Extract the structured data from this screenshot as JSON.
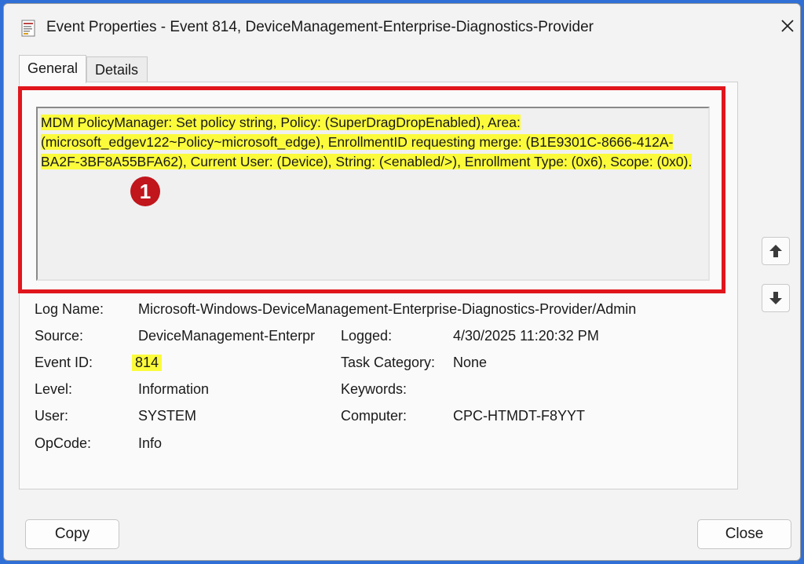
{
  "window": {
    "title": "Event Properties - Event 814, DeviceManagement-Enterprise-Diagnostics-Provider"
  },
  "tabs": [
    {
      "label": "General",
      "active": true
    },
    {
      "label": "Details",
      "active": false
    }
  ],
  "description": "MDM PolicyManager: Set policy string, Policy: (SuperDragDropEnabled), Area: (microsoft_edgev122~Policy~microsoft_edge), EnrollmentID requesting merge: (B1E9301C-8666-412A-BA2F-3BF8A55BFA62), Current User: (Device), String: (<enabled/>), Enrollment Type: (0x6), Scope: (0x0).",
  "annotation": {
    "badge": "1"
  },
  "fields": {
    "log_name": {
      "label": "Log Name:",
      "value": "Microsoft-Windows-DeviceManagement-Enterprise-Diagnostics-Provider/Admin"
    },
    "source": {
      "label": "Source:",
      "value": "DeviceManagement-Enterpr"
    },
    "logged": {
      "label": "Logged:",
      "value": "4/30/2025 11:20:32 PM"
    },
    "event_id": {
      "label": "Event ID:",
      "value": "814"
    },
    "task_category": {
      "label": "Task Category:",
      "value": "None"
    },
    "level": {
      "label": "Level:",
      "value": "Information"
    },
    "keywords": {
      "label": "Keywords:",
      "value": ""
    },
    "user": {
      "label": "User:",
      "value": "SYSTEM"
    },
    "computer": {
      "label": "Computer:",
      "value": "CPC-HTMDT-F8YYT"
    },
    "opcode": {
      "label": "OpCode:",
      "value": "Info"
    }
  },
  "buttons": {
    "copy": "Copy",
    "close": "Close"
  },
  "colors": {
    "highlight": "#fbfb3c",
    "annotation_red": "#e0161c",
    "desktop_blue": "#2f6fd6"
  }
}
